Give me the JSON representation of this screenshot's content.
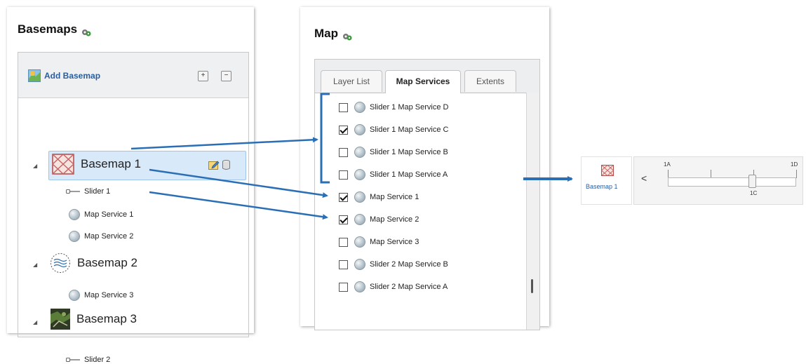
{
  "basemaps_panel": {
    "title": "Basemaps",
    "toolbar": {
      "add_label": "Add Basemap",
      "expand_icon": "expand-all-icon",
      "collapse_icon": "collapse-all-icon"
    },
    "tree": [
      {
        "label": "Basemap 1",
        "selected": true,
        "children": [
          "Slider 1",
          "Map Service 1",
          "Map Service 2"
        ]
      },
      {
        "label": "Basemap 2",
        "selected": false,
        "children": [
          "Map Service 3"
        ]
      },
      {
        "label": "Basemap 3",
        "selected": false,
        "children": [
          "Slider 2"
        ]
      }
    ]
  },
  "map_panel": {
    "title": "Map",
    "tabs": [
      {
        "label": "Layer List",
        "active": false
      },
      {
        "label": "Map Services",
        "active": true
      },
      {
        "label": "Extents",
        "active": false
      }
    ],
    "services": [
      {
        "label": "Slider 1 Map Service D",
        "checked": false
      },
      {
        "label": "Slider 1 Map Service C",
        "checked": true
      },
      {
        "label": "Slider 1 Map Service B",
        "checked": false
      },
      {
        "label": "Slider 1 Map Service A",
        "checked": false
      },
      {
        "label": "Map Service 1",
        "checked": true
      },
      {
        "label": "Map Service 2",
        "checked": true
      },
      {
        "label": "Map Service 3",
        "checked": false
      },
      {
        "label": "Slider 2 Map Service B",
        "checked": false
      },
      {
        "label": "Slider 2 Map Service A",
        "checked": false
      }
    ]
  },
  "slider_widget": {
    "basemap_label": "Basemap 1",
    "nav_glyph": "<",
    "start_label": "1A",
    "end_label": "1D",
    "current_label": "1C"
  },
  "colors": {
    "accent": "#2a6fb5",
    "selection": "#d8e9fa",
    "link": "#2a5d9e"
  }
}
